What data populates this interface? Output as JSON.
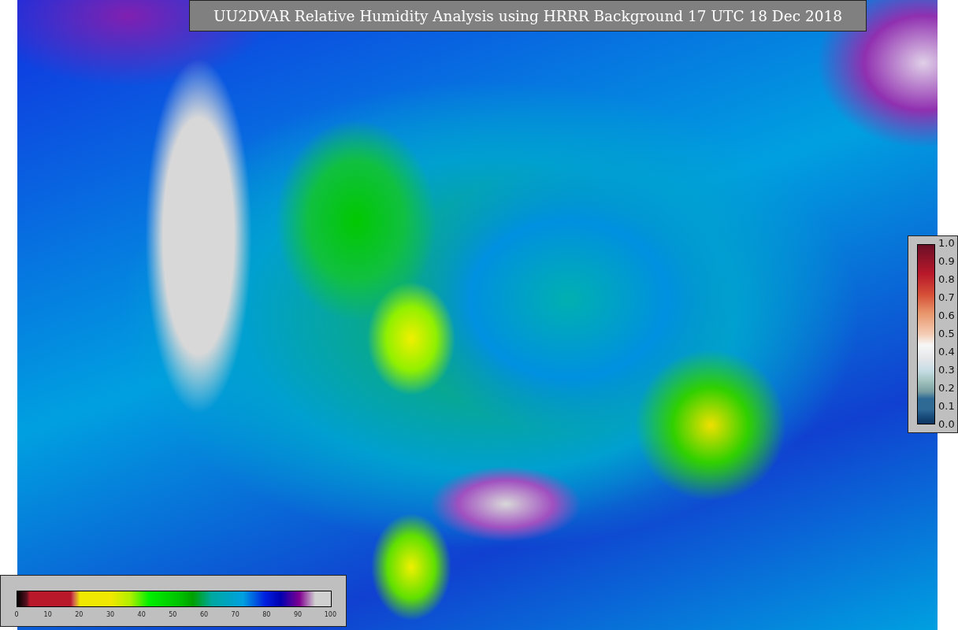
{
  "title": "UU2DVAR Relative Humidity Analysis using HRRR Background 17 UTC 18 Dec 2018",
  "station_colorbar": {
    "labels": [
      "1.0",
      "0.9",
      "0.8",
      "0.7",
      "0.6",
      "0.5",
      "0.4",
      "0.3",
      "0.2",
      "0.1",
      "0.0"
    ]
  },
  "humidity_colorbar": {
    "labels": [
      "0",
      "10",
      "20",
      "30",
      "40",
      "50",
      "60",
      "70",
      "80",
      "90",
      "100"
    ]
  }
}
